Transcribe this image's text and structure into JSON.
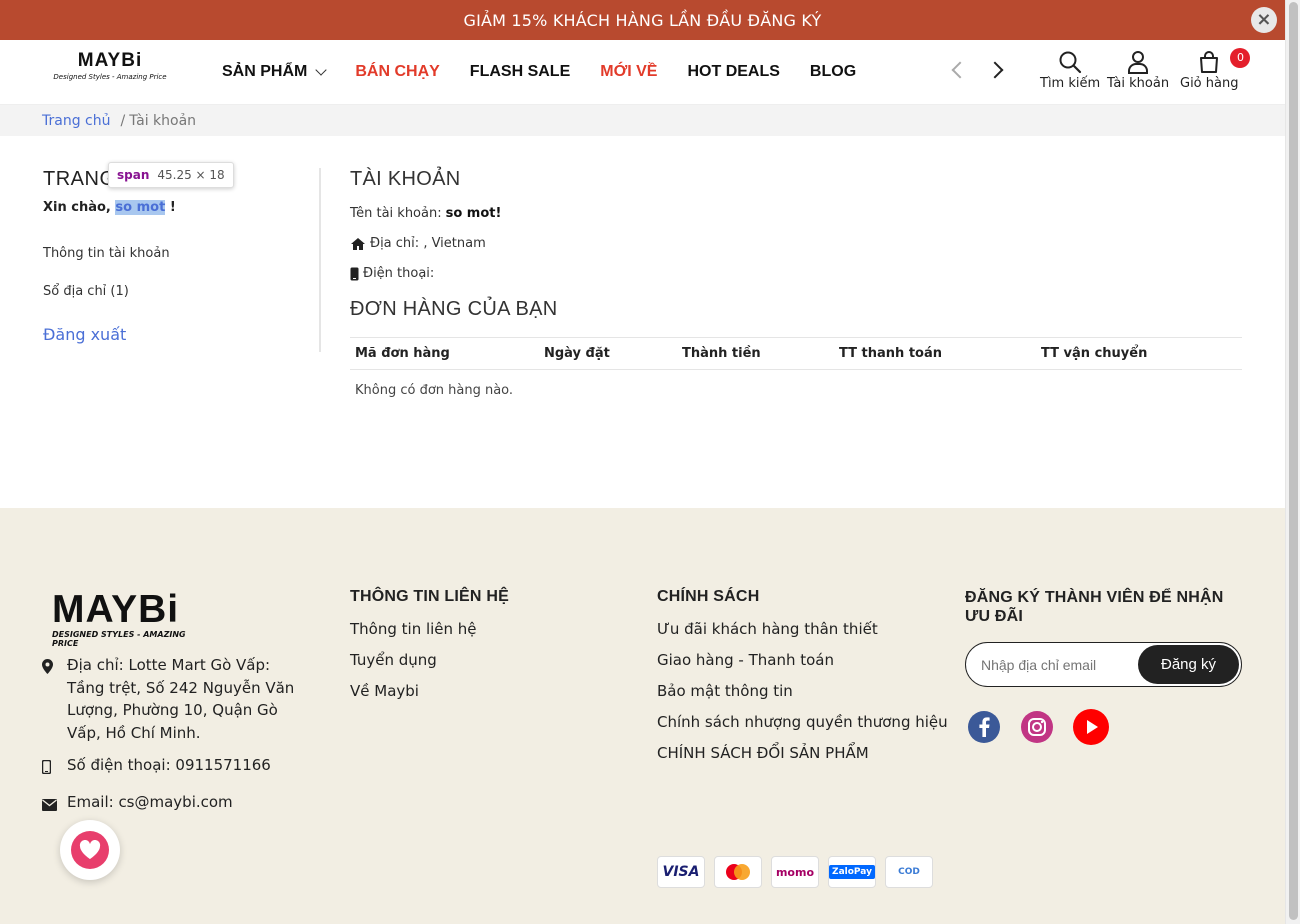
{
  "promo": {
    "text": "GIẢM 15% KHÁCH HÀNG LẦN ĐẦU ĐĂNG KÝ",
    "close": "×"
  },
  "header": {
    "logo": {
      "main": "MAYBi",
      "tagline": "Designed Styles - Amazing Price"
    },
    "nav": [
      {
        "label": "SẢN PHẨM",
        "has_dropdown": true,
        "color": "#111111"
      },
      {
        "label": "BÁN CHẠY",
        "color": "#e23b2a"
      },
      {
        "label": "FLASH SALE",
        "color": "#111111"
      },
      {
        "label": "MỚI VỀ",
        "color": "#e23b2a"
      },
      {
        "label": "HOT DEALS",
        "color": "#111111"
      },
      {
        "label": "BLOG",
        "color": "#111111"
      }
    ],
    "search_label": "Tìm kiếm",
    "account_label": "Tài khoản",
    "cart_label": "Giỏ hàng",
    "cart_count": "0"
  },
  "breadcrumb": {
    "home": "Trang chủ",
    "sep": "/",
    "current": "Tài khoản"
  },
  "sidebar": {
    "title": "TRANG",
    "hello_prefix": "Xin chào,",
    "username": "so mot",
    "hello_suffix": "!",
    "links": [
      "Thông tin tài khoản",
      "Sổ địa chỉ (1)"
    ],
    "logout": "Đăng xuất"
  },
  "devtools_tooltip": {
    "tag": "span",
    "dims": "45.25 × 18"
  },
  "account": {
    "title": "TÀI KHOẢN",
    "name_label": "Tên tài khoản:",
    "name_value": "so mot!",
    "address_label": "Địa chỉ:",
    "address_value": ", Vietnam",
    "phone_label": "Điện thoại:"
  },
  "orders": {
    "title": "ĐƠN HÀNG CỦA BẠN",
    "columns": [
      "Mã đơn hàng",
      "Ngày đặt",
      "Thành tiền",
      "TT thanh toán",
      "TT vận chuyển"
    ],
    "empty": "Không có đơn hàng nào."
  },
  "footer": {
    "logo": {
      "main": "MAYBi",
      "tagline": "DESIGNED STYLES - AMAZING PRICE"
    },
    "address": "Địa chỉ: Lotte Mart Gò Vấp: Tầng trệt, Số 242 Nguyễn Văn Lượng, Phường 10, Quận Gò Vấp, Hồ Chí Minh.",
    "phone": "Số điện thoại: 0911571166",
    "email": "Email: cs@maybi.com",
    "contact_col": {
      "title": "THÔNG TIN LIÊN HỆ",
      "links": [
        "Thông tin liên hệ",
        "Tuyển dụng",
        "Về Maybi"
      ]
    },
    "policy_col": {
      "title": "CHÍNH SÁCH",
      "links": [
        "Ưu đãi khách hàng thân thiết",
        "Giao hàng - Thanh toán",
        "Bảo mật thông tin",
        "Chính sách nhượng quyền thương hiệu",
        "CHÍNH SÁCH ĐỔI SẢN PHẨM"
      ]
    },
    "signup_col": {
      "title": "ĐĂNG KÝ THÀNH VIÊN ĐỂ NHẬN ƯU ĐÃI",
      "placeholder": "Nhập địa chỉ email",
      "button": "Đăng ký"
    },
    "social_icons": [
      "facebook-icon",
      "instagram-icon",
      "youtube-icon"
    ],
    "payments": [
      "VISA",
      "mastercard",
      "momo",
      "ZaloPay",
      "COD"
    ]
  },
  "colors": {
    "promo_bg": "#b84a2f",
    "accent_red": "#e23b2a",
    "link_blue": "#4a6fd6",
    "footer_bg": "#f2eee3",
    "badge_red": "#e41f2b"
  }
}
